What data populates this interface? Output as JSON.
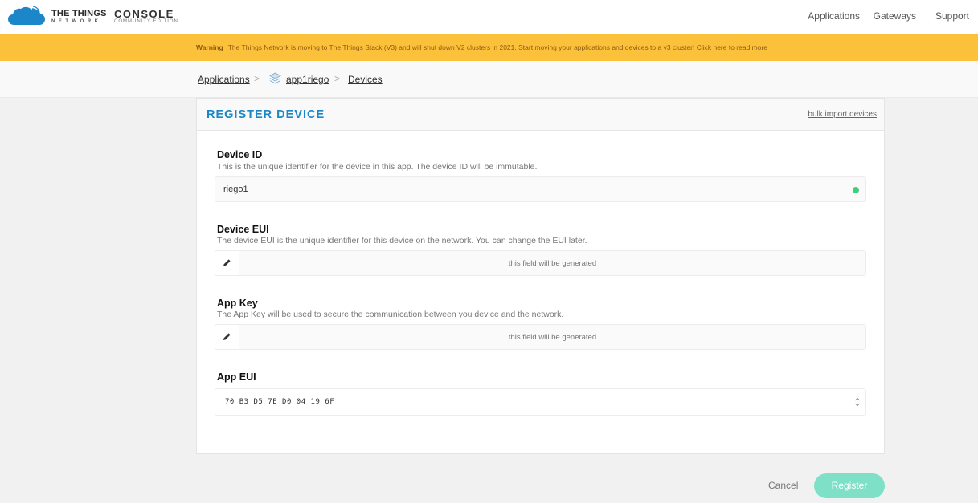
{
  "brand": {
    "name_top": "THE THINGS",
    "name_bottom": "NETWORK",
    "console": "CONSOLE",
    "edition": "COMMUNITY EDITION"
  },
  "nav": {
    "applications": "Applications",
    "gateways": "Gateways",
    "support": "Support"
  },
  "warning": {
    "label": "Warning",
    "text": "The Things Network is moving to The Things Stack (V3) and will shut down V2 clusters in 2021. Start moving your applications and devices to a v3 cluster! Click here to read more"
  },
  "breadcrumb": {
    "applications": "Applications",
    "app": "app1riego",
    "devices": "Devices",
    "separator": ">"
  },
  "card": {
    "title": "REGISTER DEVICE",
    "bulk_link": "bulk import devices"
  },
  "fields": {
    "device_id": {
      "label": "Device ID",
      "description": "This is the unique identifier for the device in this app. The device ID will be immutable.",
      "value": "riego1"
    },
    "device_eui": {
      "label": "Device EUI",
      "description": "The device EUI is the unique identifier for this device on the network. You can change the EUI later.",
      "placeholder": "this field will be generated"
    },
    "app_key": {
      "label": "App Key",
      "description": "The App Key will be used to secure the communication between you device and the network.",
      "placeholder": "this field will be generated"
    },
    "app_eui": {
      "label": "App EUI",
      "value": "70 B3 D5 7E D0 04 19 6F"
    }
  },
  "actions": {
    "cancel": "Cancel",
    "register": "Register"
  },
  "colors": {
    "accent": "#1b86c8",
    "warning_bg": "#fcc13b",
    "valid": "#39d279",
    "register_bg": "#7ee0c6"
  }
}
